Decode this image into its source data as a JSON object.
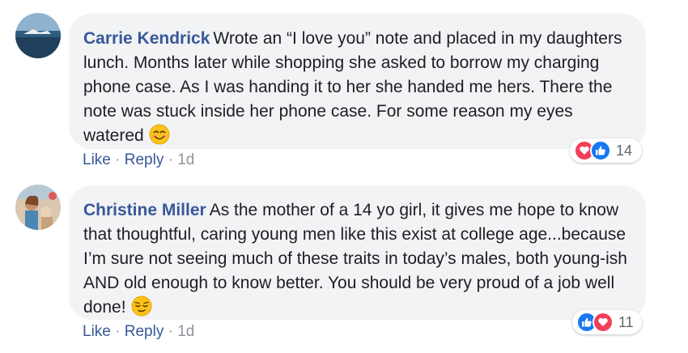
{
  "comments": [
    {
      "author": "Carrie Kendrick",
      "text": "Wrote an “I love you” note and placed in my daughters lunch. Months later while shopping she asked to borrow my charging phone case. As I was handing it to her she handed me hers. There the note was stuck inside her phone case. For some reason my eyes watered",
      "emoji": "smiling-face-icon",
      "reaction_icons": [
        "love-icon",
        "like-icon"
      ],
      "reaction_count": "14",
      "like_label": "Like",
      "reply_label": "Reply",
      "separator": "·",
      "time": "1d"
    },
    {
      "author": "Christine Miller",
      "text": "As the mother of a 14 yo girl, it gives me hope to know that thoughtful, caring young men like this exist at college age...because I’m sure not seeing much of these traits in today’s males, both young-ish AND old enough to know better. You should be very proud of a job well done!",
      "emoji": "relieved-face-icon",
      "reaction_icons": [
        "like-icon",
        "love-icon"
      ],
      "reaction_count": "11",
      "like_label": "Like",
      "reply_label": "Reply",
      "separator": "·",
      "time": "1d"
    }
  ],
  "colors": {
    "author": "#385898",
    "bubble": "#f2f3f5",
    "love": "#f33e58",
    "like": "#1877f2",
    "meta": "#90949c"
  }
}
